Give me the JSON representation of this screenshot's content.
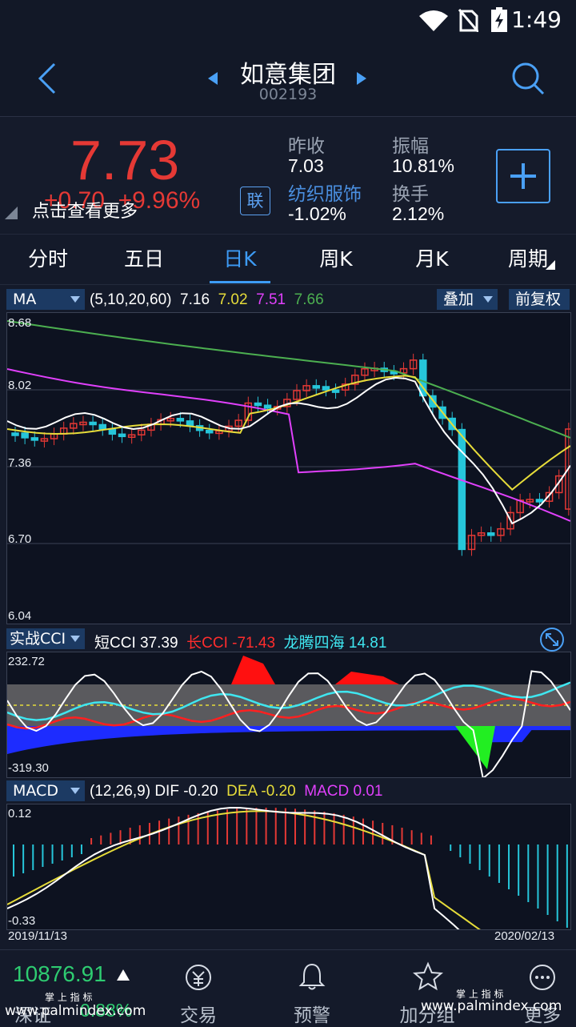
{
  "status": {
    "time": "1:49"
  },
  "header": {
    "title": "如意集团",
    "code": "002193"
  },
  "quote": {
    "price": "7.73",
    "change": "+0.70",
    "change_pct": "+9.96%",
    "tip": "点击查看更多",
    "link_badge": "联",
    "prev_close_label": "昨收",
    "prev_close": "7.03",
    "amplitude_label": "振幅",
    "amplitude": "10.81%",
    "sector_label": "纺织服饰",
    "sector_change": "-1.02%",
    "turnover_label": "换手",
    "turnover": "2.12%"
  },
  "tabs": [
    "分时",
    "五日",
    "日K",
    "周K",
    "月K",
    "周期"
  ],
  "active_tab": "日K",
  "ma_bar": {
    "selector": "MA",
    "params": "(5,10,20,60)",
    "v1": "7.16",
    "v2": "7.02",
    "v3": "7.51",
    "v4": "7.66",
    "overlay": "叠加",
    "adjust": "前复权"
  },
  "price_axis": [
    "8.68",
    "8.02",
    "7.36",
    "6.70",
    "6.04"
  ],
  "cci_bar": {
    "selector": "实战CCI",
    "short_label": "短CCI",
    "short_val": "37.39",
    "long_label": "长CCI",
    "long_val": "-71.43",
    "dragon_label": "龙腾四海",
    "dragon_val": "14.81"
  },
  "cci_axis": [
    "232.72",
    "-319.30"
  ],
  "macd_bar": {
    "selector": "MACD",
    "params": "(12,26,9)",
    "dif_label": "DIF",
    "dif": "-0.20",
    "dea_label": "DEA",
    "dea": "-0.20",
    "macd_label": "MACD",
    "macd": "0.01"
  },
  "macd_axis": [
    "0.12",
    "-0.33"
  ],
  "dates": [
    "2019/11/13",
    "2020/02/13"
  ],
  "bottom_nav": {
    "index_value": "10876.91",
    "index_name": "深证",
    "index_change": "0.88%",
    "items": [
      "交易",
      "预警",
      "加分组",
      "更多"
    ]
  },
  "watermark": "www.palmindex.com",
  "watermark_cn": "掌 上 指 标",
  "colors": {
    "up": "#e53935",
    "down": "#26c6da",
    "accent": "#3d9bf5",
    "ma5": "#ffffff",
    "ma10": "#e6dc3a",
    "ma20": "#e040fb",
    "ma60": "#4caf50"
  }
}
